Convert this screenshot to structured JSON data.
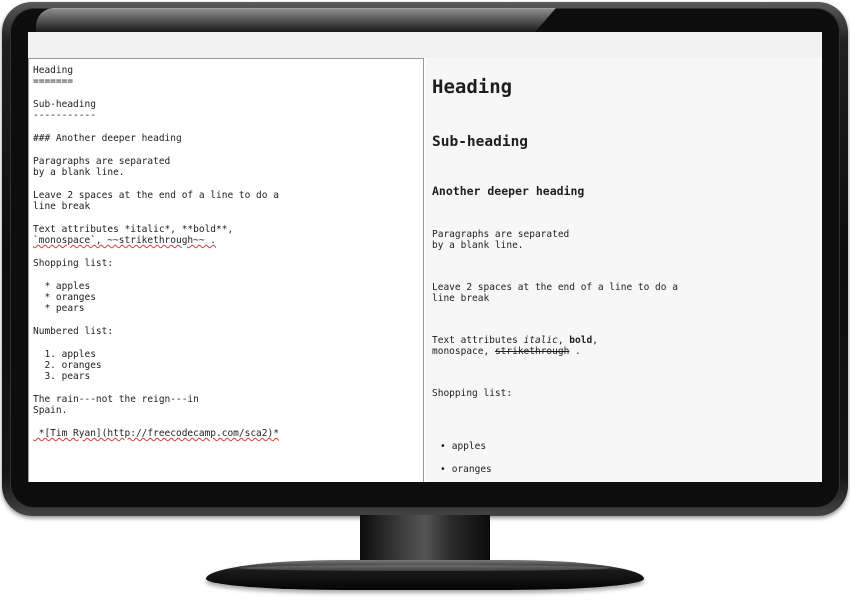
{
  "editor": {
    "lines": [
      "Heading",
      "=======",
      "Sub-heading",
      "-----------",
      "### Another deeper heading",
      "Paragraphs are separated",
      "by a blank line.",
      "Leave 2 spaces at the end of a line to do a",
      "line break",
      "Text attributes *italic*, **bold**,",
      "`monospace`, ~~strikethrough~~ .",
      "Shopping list:",
      "  * apples",
      "  * oranges",
      "  * pears",
      "Numbered list:",
      "  1. apples",
      "  2. oranges",
      "  3. pears",
      "The rain---not the reign---in",
      "Spain.",
      " *[Tim Ryan](http://freecodecamp.com/sca2)*"
    ]
  },
  "preview": {
    "h1": "Heading",
    "h2": "Sub-heading",
    "h3": "Another deeper heading",
    "para1_line1": "Paragraphs are separated",
    "para1_line2": "by a blank line.",
    "para2_line1": "Leave 2 spaces at the end of a line to do a",
    "para2_line2": "line break",
    "text_attr_prefix": "Text attributes ",
    "italic": "italic",
    "comma1": ", ",
    "bold": "bold",
    "comma2": ",",
    "monospace": "monospace",
    "comma3": ", ",
    "strikethrough": "strikethrough",
    "period": " .",
    "shopping_label": "Shopping list:",
    "bullets": [
      "apples",
      "oranges"
    ]
  }
}
